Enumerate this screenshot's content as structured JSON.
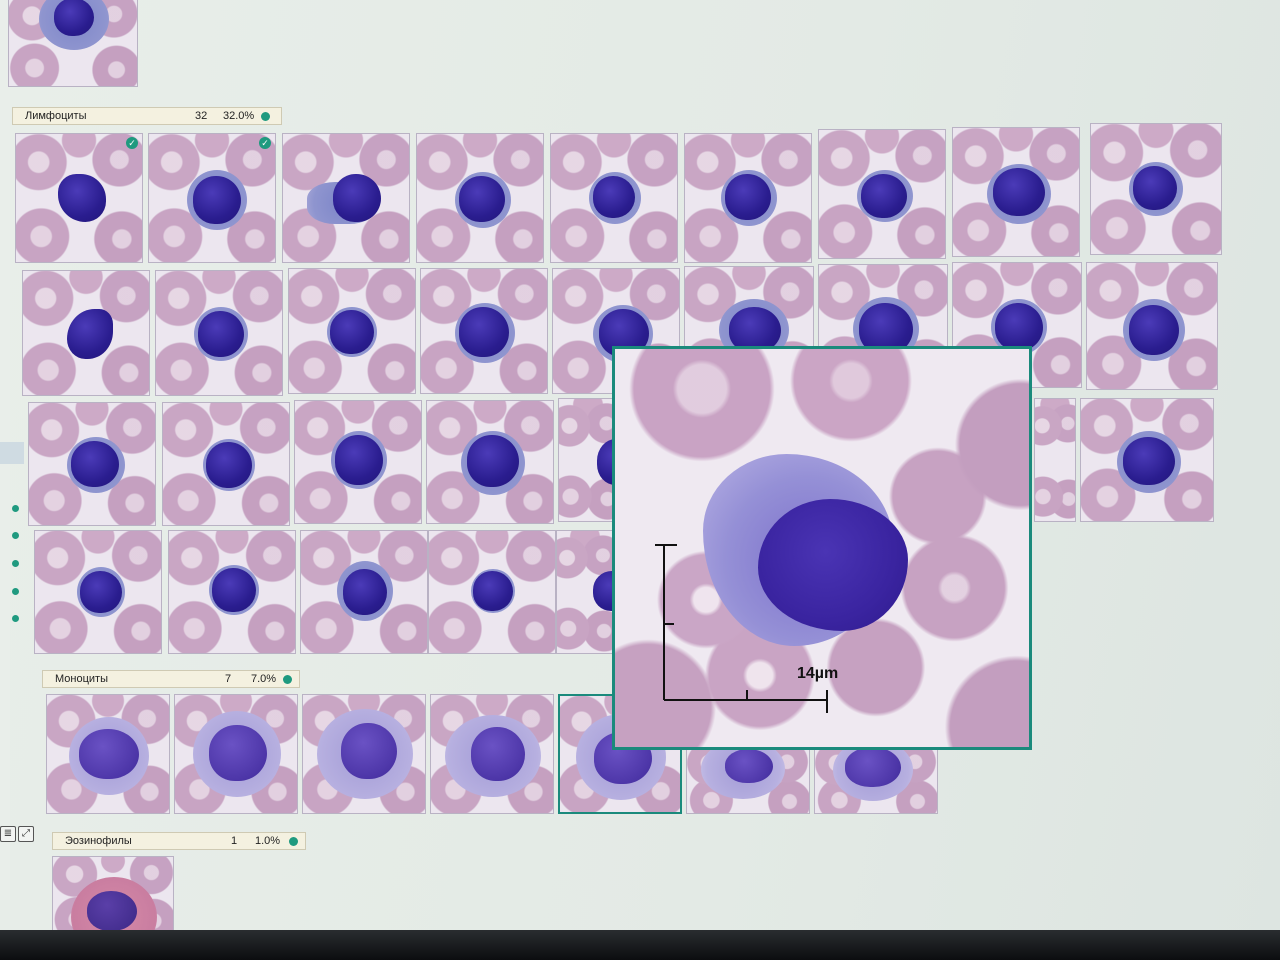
{
  "categories": [
    {
      "id": "lymph",
      "name": "Лимфоциты",
      "count": "32",
      "percent": "32.0%"
    },
    {
      "id": "mono",
      "name": "Моноциты",
      "count": "7",
      "percent": "7.0%"
    },
    {
      "id": "eos",
      "name": "Эозинофилы",
      "count": "1",
      "percent": "1.0%"
    }
  ],
  "zoom": {
    "scale_label": "14µm"
  },
  "colors": {
    "accent": "#1a8a7c",
    "status_dot": "#1f9a7f",
    "header_bg": "#f4f1e0"
  },
  "icons": {
    "check": "check-icon",
    "list": "list-icon",
    "expand": "expand-icon"
  }
}
